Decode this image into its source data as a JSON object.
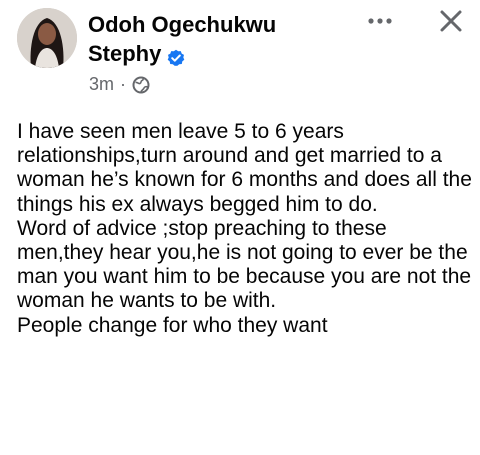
{
  "post": {
    "author_line1": "Odoh Ogechukwu",
    "author_line2": "Stephy",
    "timestamp": "3m",
    "separator": "·",
    "privacy_icon": "globe-icon",
    "verified_icon": "verified-badge-icon",
    "more_icon": "more-options-icon",
    "close_icon": "close-icon",
    "colors": {
      "text": "#050505",
      "meta": "#65676b",
      "verified": "#1877f2"
    },
    "paragraphs": [
      "I have seen men leave 5 to 6 years relationships,turn around and get married to a woman he’s known for 6 months and does all the things his ex always begged him to do.",
      "Word of advice ;stop preaching to these men,they hear you,he is not going to ever be the man you want him to be because you are not the woman he wants to be with.",
      "People change for who they want"
    ]
  }
}
